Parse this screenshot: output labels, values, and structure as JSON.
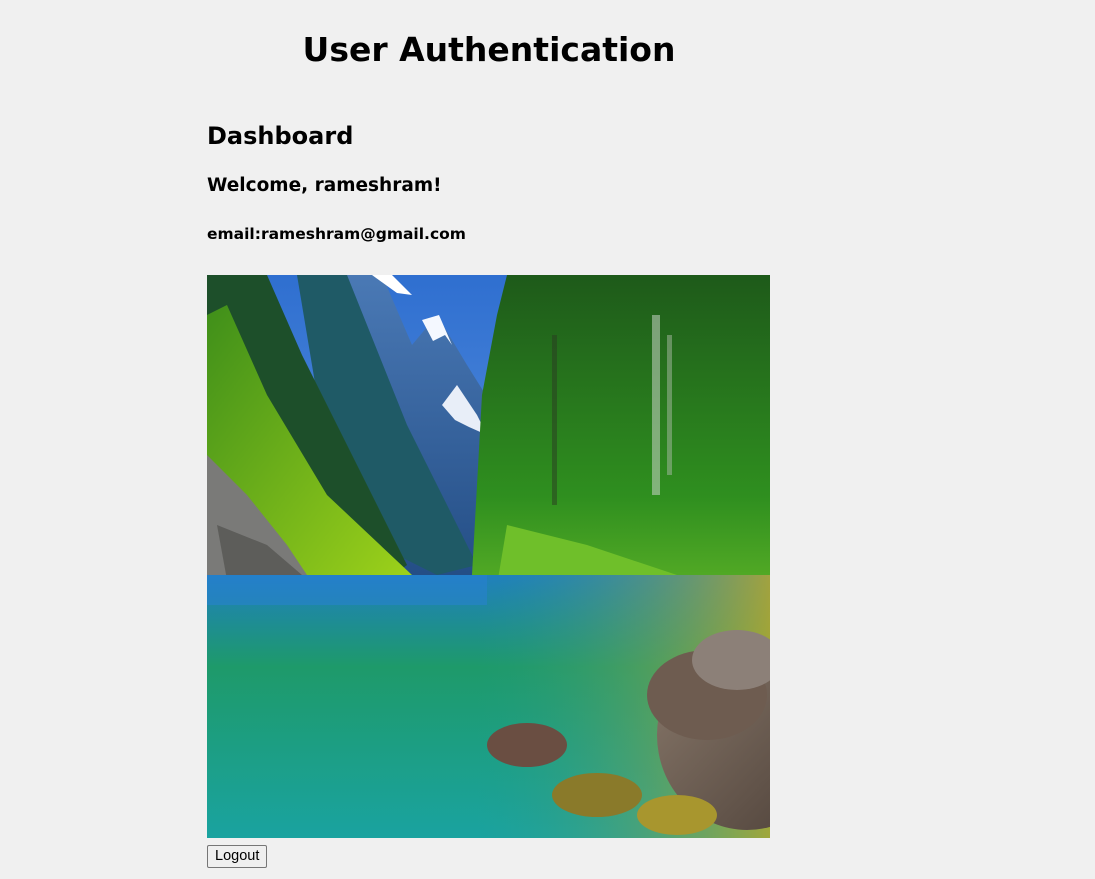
{
  "app": {
    "title": "User Authentication"
  },
  "dashboard": {
    "heading": "Dashboard",
    "welcome": "Welcome, rameshram!",
    "email": "email:rameshram@gmail.com",
    "image_subject": "mountain lake landscape with forest and rocks"
  },
  "actions": {
    "logout_label": "Logout"
  },
  "colors": {
    "page_background": "#f0f0f0",
    "text": "#000000",
    "button_background": "#efefef",
    "button_border": "#767676"
  }
}
